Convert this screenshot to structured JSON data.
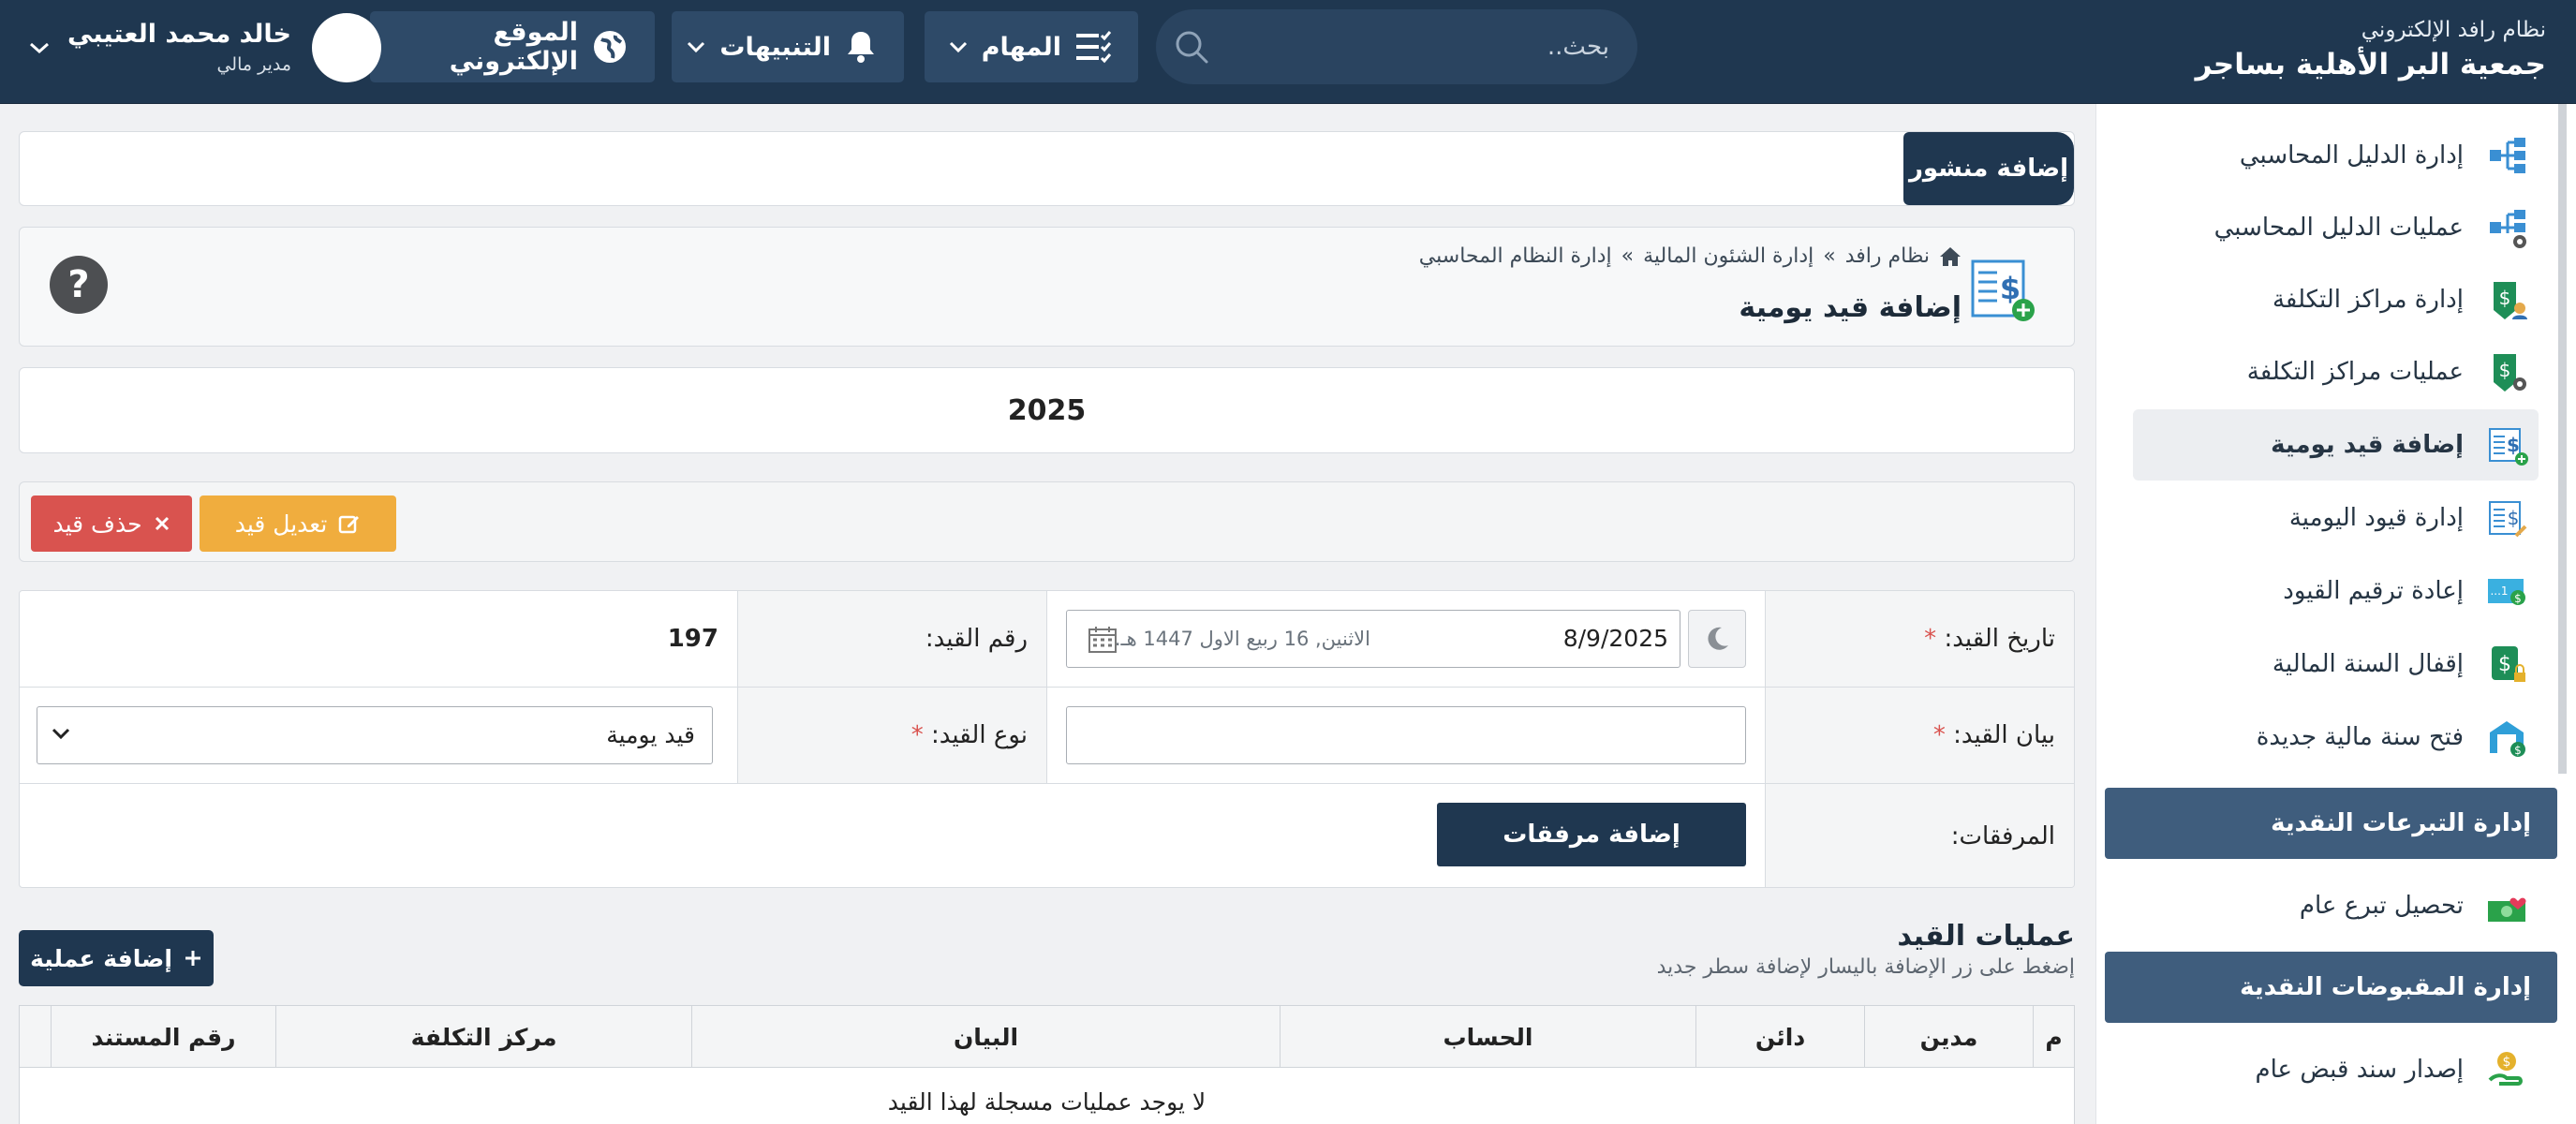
{
  "header": {
    "system_name": "نظام رافد الإلكتروني",
    "org_name": "جمعية البر الأهلية بساجر",
    "search_placeholder": "بحث..",
    "tasks_label": "المهام",
    "alerts_label": "التنبيهات",
    "website_label": "الموقع الإلكتروني",
    "user_name": "خالد محمد العتيبي",
    "user_role": "مدير مالي"
  },
  "sidebar": {
    "items": [
      {
        "label": "إدارة الدليل المحاسبي",
        "icon": "chart-of-accounts-icon"
      },
      {
        "label": "عمليات الدليل المحاسبي",
        "icon": "accounts-operations-icon"
      },
      {
        "label": "إدارة مراكز التكلفة",
        "icon": "cost-centers-icon"
      },
      {
        "label": "عمليات مراكز التكلفة",
        "icon": "cost-centers-operations-icon"
      },
      {
        "label": "إضافة قيد يومية",
        "icon": "add-journal-entry-icon"
      },
      {
        "label": "إدارة قيود اليومية",
        "icon": "journal-entries-icon"
      },
      {
        "label": "إعادة ترقيم القيود",
        "icon": "renumber-entries-icon"
      },
      {
        "label": "إقفال السنة المالية",
        "icon": "close-fiscal-year-icon"
      },
      {
        "label": "فتح سنة مالية جديدة",
        "icon": "open-fiscal-year-icon"
      }
    ],
    "section_cash_donations": "إدارة التبرعات النقدية",
    "donation_item": "تحصيل تبرع عام",
    "section_cash_receipts": "إدارة المقبوضات النقدية",
    "receipt_item": "إصدار سند قبض عام"
  },
  "main": {
    "add_post_label": "إضافة منشور",
    "breadcrumb": [
      "نظام رافد",
      "إدارة الشئون المالية",
      "إدارة النظام المحاسبي"
    ],
    "page_title": "إضافة قيد يومية",
    "year": "2025",
    "edit_entry_label": "تعديل قيد",
    "delete_entry_label": "حذف قيد",
    "form": {
      "date_label": "تاريخ القيد:",
      "date_value": "8/9/2025",
      "hijri_date": "الاثنين, 16 ربيع الاول 1447 هـ.",
      "number_label": "رقم القيد:",
      "number_value": "197",
      "description_label": "بيان القيد:",
      "type_label": "نوع القيد:",
      "type_value": "قيد يومية",
      "attachments_label": "المرفقات:",
      "add_attachments_label": "إضافة مرفقات"
    },
    "operations_title": "عمليات القيد",
    "operations_hint": "إضغط على زر الإضافة باليسار لإضافة سطر جديد",
    "add_operation_label": "إضافة عملية",
    "table_headers": [
      "م",
      "مدين",
      "دائن",
      "الحساب",
      "البيان",
      "مركز التكلفة",
      "رقم المستند"
    ],
    "empty_message": "لا يوجد عمليات مسجلة لهذا القيد"
  },
  "colors": {
    "header_bg": "#1f3750",
    "sidebar_section_bg": "#3f5d7d",
    "edit_button": "#f0ad3e",
    "delete_button": "#d9534f",
    "required_marker": "#d9534f"
  }
}
